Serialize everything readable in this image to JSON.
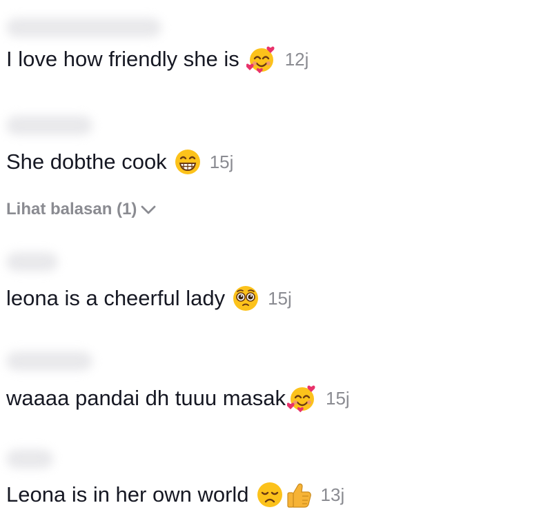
{
  "comments": [
    {
      "text": "I love how friendly she is",
      "emoji": [
        "smiling-face-with-hearts-icon"
      ],
      "time": "12j"
    },
    {
      "text": "She dobthe cook",
      "emoji": [
        "beaming-face-icon"
      ],
      "time": "15j"
    },
    {
      "text": "leona is a cheerful lady",
      "emoji": [
        "pleading-face-icon"
      ],
      "time": "15j"
    },
    {
      "text": "waaaa pandai dh tuuu masak",
      "emoji": [
        "smiling-face-with-hearts-icon"
      ],
      "time": "15j"
    },
    {
      "text": "Leona is in her own world",
      "emoji": [
        "disappointed-face-icon",
        "thumbs-up-icon"
      ],
      "time": "13j"
    }
  ],
  "replies_toggle": {
    "label": "Lihat balasan (1)",
    "icon": "chevron-down-icon"
  },
  "colors": {
    "text": "#161823",
    "secondary": "#8a8b91",
    "emoji_yellow": "#fcc21b",
    "heart": "#e8336b",
    "thumb": "#f6b336"
  }
}
